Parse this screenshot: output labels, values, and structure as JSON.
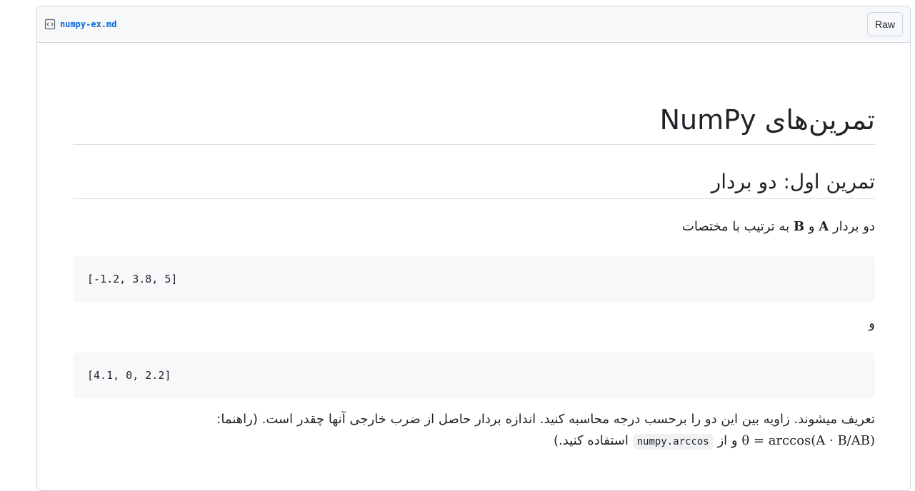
{
  "file": {
    "name": "numpy-ex.md",
    "raw_label": "Raw"
  },
  "content": {
    "title": "تمرین‌های NumPy",
    "section1_heading": "تمرین اول: دو بردار",
    "intro": {
      "before": "دو بردار",
      "a": "A",
      "and": "و",
      "b": "B",
      "after": "به ترتیب با مختصات"
    },
    "vector_a": "[-1.2, 3.8, 5]",
    "and_word": "و",
    "vector_b": "[4.1, 0, 2.2]",
    "task": {
      "line1": "تعریف میشوند. زاویه بین این دو را برحسب درجه محاسبه کنید. اندازه بردار حاصل از ضرب خارجی آنها چقدر است. (راهنما:",
      "formula": "θ = arccos(A · B/AB)",
      "and_from": "و از",
      "code": "numpy.arccos",
      "end": "استفاده کنید.)"
    }
  }
}
